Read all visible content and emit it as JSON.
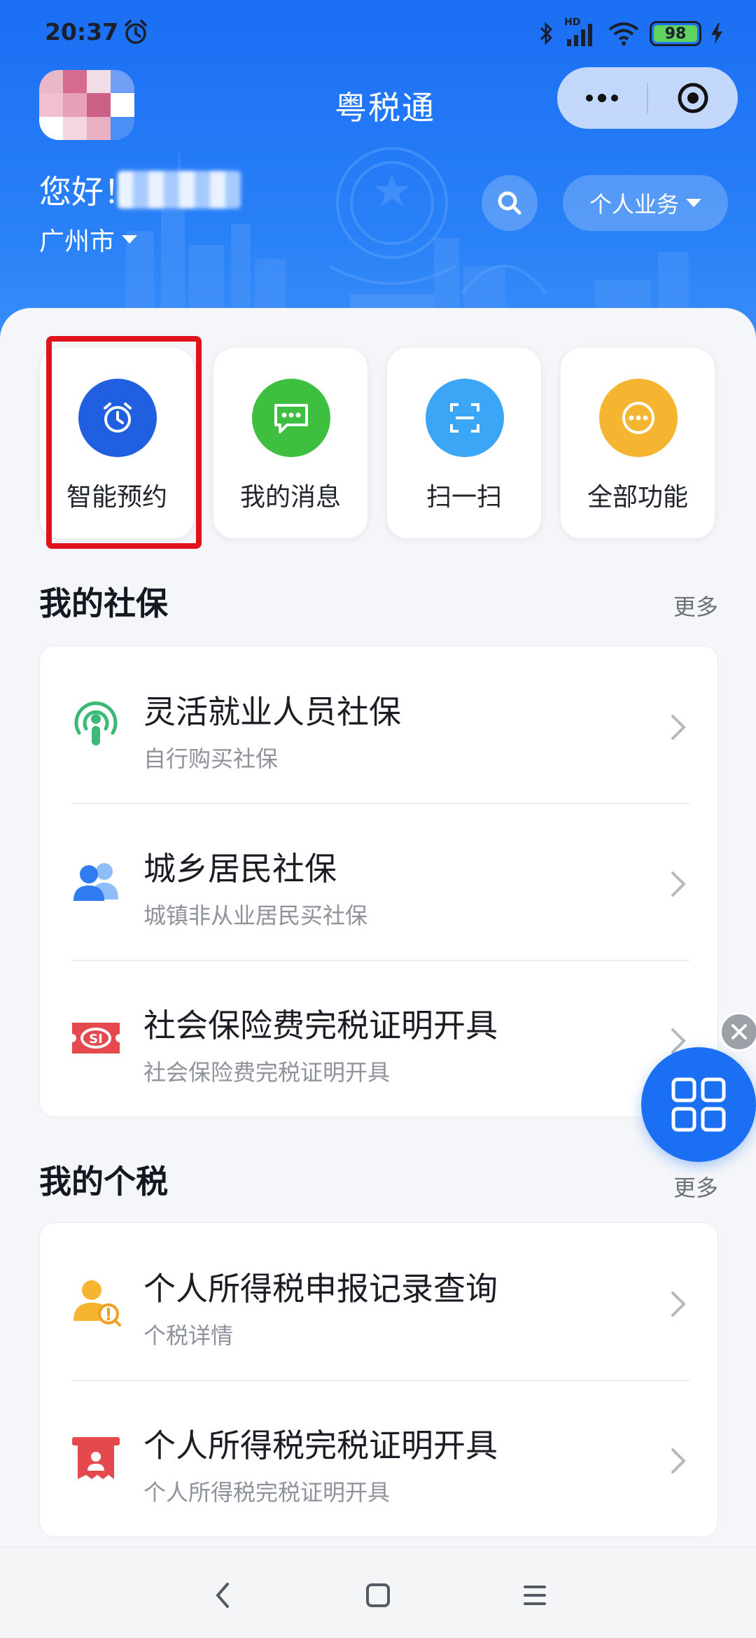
{
  "status_bar": {
    "time": "20:37",
    "network_label": "HD",
    "battery_level": "98"
  },
  "header": {
    "app_title": "粤税通",
    "greeting": "您好！",
    "city": "广州市",
    "business_button": "个人业务"
  },
  "quick_actions": [
    {
      "label": "智能预约",
      "icon": "alarm-clock-icon",
      "color": "#1f5fe0"
    },
    {
      "label": "我的消息",
      "icon": "chat-bubble-icon",
      "color": "#3fbf3f"
    },
    {
      "label": "扫一扫",
      "icon": "scan-icon",
      "color": "#3aa6f5"
    },
    {
      "label": "全部功能",
      "icon": "more-dots-icon",
      "color": "#f5b531"
    }
  ],
  "social_security": {
    "title": "我的社保",
    "more": "更多",
    "items": [
      {
        "title": "灵活就业人员社保",
        "subtitle": "自行购买社保",
        "icon": "broadcast-person-icon"
      },
      {
        "title": "城乡居民社保",
        "subtitle": "城镇非从业居民买社保",
        "icon": "people-icon"
      },
      {
        "title": "社会保险费完税证明开具",
        "subtitle": "社会保险费完税证明开具",
        "icon": "si-ticket-icon"
      }
    ]
  },
  "personal_tax": {
    "title": "我的个税",
    "more": "更多",
    "items": [
      {
        "title": "个人所得税申报记录查询",
        "subtitle": "个税详情",
        "icon": "person-search-icon"
      },
      {
        "title": "个人所得税完税证明开具",
        "subtitle": "个人所得税完税证明开具",
        "icon": "receipt-icon"
      }
    ]
  },
  "colors": {
    "header_blue": "#1a6ef4",
    "highlight_red": "#e0131c",
    "float_button_blue": "#1a6ff3"
  }
}
